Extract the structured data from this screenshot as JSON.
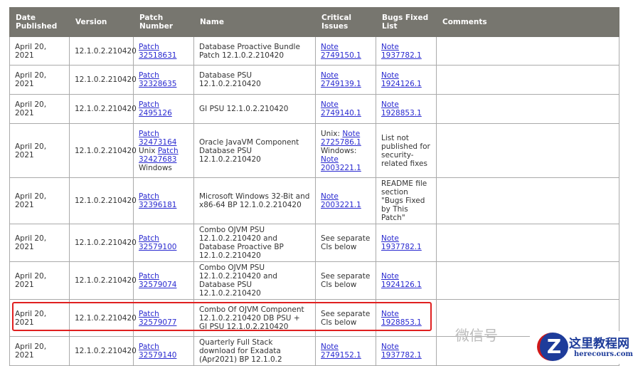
{
  "headers": [
    "Date Published",
    "Version",
    "Patch Number",
    "Name",
    "Critical Issues",
    "Bugs Fixed List",
    "Comments"
  ],
  "rows": [
    {
      "h": 40,
      "cells": [
        [
          {
            "t": "April 20, 2021"
          }
        ],
        [
          {
            "t": "12.1.0.2.210420"
          }
        ],
        [
          {
            "t": "Patch 32518631",
            "l": 1
          }
        ],
        [
          {
            "t": "Database Proactive Bundle Patch 12.1.0.2.210420"
          }
        ],
        [
          {
            "t": "Note 2749150.1",
            "l": 1
          }
        ],
        [
          {
            "t": "Note 1937782.1",
            "l": 1
          }
        ],
        []
      ]
    },
    {
      "h": 41,
      "cells": [
        [
          {
            "t": "April 20, 2021"
          }
        ],
        [
          {
            "t": "12.1.0.2.210420"
          }
        ],
        [
          {
            "t": "Patch 32328635",
            "l": 1
          }
        ],
        [
          {
            "t": "Database PSU 12.1.0.2.210420"
          }
        ],
        [
          {
            "t": "Note 2749139.1",
            "l": 1
          }
        ],
        [
          {
            "t": "Note 1924126.1",
            "l": 1
          }
        ],
        []
      ]
    },
    {
      "h": 41,
      "cells": [
        [
          {
            "t": "April 20, 2021"
          }
        ],
        [
          {
            "t": "12.1.0.2.210420"
          }
        ],
        [
          {
            "t": "Patch 2495126",
            "l": 1
          }
        ],
        [
          {
            "t": "GI PSU 12.1.0.2.210420"
          }
        ],
        [
          {
            "t": "Note 2749140.1",
            "l": 1
          }
        ],
        [
          {
            "t": "Note 1928853.1",
            "l": 1
          }
        ],
        []
      ]
    },
    {
      "h": 76,
      "cells": [
        [
          {
            "t": "April 20, 2021"
          }
        ],
        [
          {
            "t": "12.1.0.2.210420"
          }
        ],
        [
          {
            "t": "Patch 32473164",
            "l": 1
          },
          {
            "t": " Unix "
          },
          {
            "t": "Patch 32427683",
            "l": 1
          },
          {
            "t": " Windows"
          }
        ],
        [
          {
            "t": "Oracle JavaVM Component Database PSU 12.1.0.2.210420"
          }
        ],
        [
          {
            "t": "Unix: "
          },
          {
            "t": "Note 2725786.1",
            "l": 1
          },
          {
            "t": " Windows: "
          },
          {
            "t": "Note 2003221.1",
            "l": 1
          }
        ],
        [
          {
            "t": "List not published for security-related fixes"
          }
        ],
        []
      ]
    },
    {
      "h": 64,
      "cells": [
        [
          {
            "t": "April 20, 2021"
          }
        ],
        [
          {
            "t": "12.1.0.2.210420"
          }
        ],
        [
          {
            "t": "Patch 32396181",
            "l": 1
          }
        ],
        [
          {
            "t": "Microsoft Windows 32-Bit and x86-64 BP 12.1.0.2.210420"
          }
        ],
        [
          {
            "t": "Note 2003221.1",
            "l": 1
          }
        ],
        [
          {
            "t": "README file section \"Bugs Fixed by This Patch\""
          }
        ],
        []
      ]
    },
    {
      "h": 53,
      "cells": [
        [
          {
            "t": "April 20, 2021"
          }
        ],
        [
          {
            "t": "12.1.0.2.210420"
          }
        ],
        [
          {
            "t": "Patch 32579100",
            "l": 1
          }
        ],
        [
          {
            "t": "Combo OJVM PSU 12.1.0.2.210420 and Database Proactive BP 12.1.0.2.210420"
          }
        ],
        [
          {
            "t": "See separate CIs below"
          }
        ],
        [
          {
            "t": "Note 1937782.1",
            "l": 1
          }
        ],
        []
      ]
    },
    {
      "h": 53,
      "cells": [
        [
          {
            "t": "April 20, 2021"
          }
        ],
        [
          {
            "t": "12.1.0.2.210420"
          }
        ],
        [
          {
            "t": "Patch 32579074",
            "l": 1
          }
        ],
        [
          {
            "t": "Combo OJVM PSU 12.1.0.2.210420 and Database PSU 12.1.0.2.210420"
          }
        ],
        [
          {
            "t": "See separate CIs below"
          }
        ],
        [
          {
            "t": "Note 1924126.1",
            "l": 1
          }
        ],
        []
      ]
    },
    {
      "h": 52,
      "cells": [
        [
          {
            "t": "April 20, 2021"
          }
        ],
        [
          {
            "t": "12.1.0.2.210420"
          }
        ],
        [
          {
            "t": "Patch 32579077",
            "l": 1
          }
        ],
        [
          {
            "t": "Combo Of OJVM Component 12.1.0.2.210420 DB PSU + GI PSU 12.1.0.2.210420"
          }
        ],
        [
          {
            "t": "See separate CIs below"
          }
        ],
        [
          {
            "t": "Note 1928853.1",
            "l": 1
          }
        ],
        []
      ]
    },
    {
      "h": 41,
      "cells": [
        [
          {
            "t": "April 20, 2021"
          }
        ],
        [
          {
            "t": "12.1.0.2.210420"
          }
        ],
        [
          {
            "t": "Patch 32579140",
            "l": 1
          }
        ],
        [
          {
            "t": "Quarterly Full Stack download for Exadata (Apr2021) BP 12.1.0.2"
          }
        ],
        [
          {
            "t": "Note 2749152.1",
            "l": 1
          }
        ],
        [
          {
            "t": "Note 1937782.1",
            "l": 1
          }
        ],
        []
      ]
    }
  ],
  "watermark": "微信号",
  "logo": {
    "text": "这里教程网",
    "url": "herecours.com",
    "letter": "Z"
  },
  "colors": {
    "header": "#77766f",
    "link": "#2a2ad0",
    "highlight": "#e02020"
  }
}
